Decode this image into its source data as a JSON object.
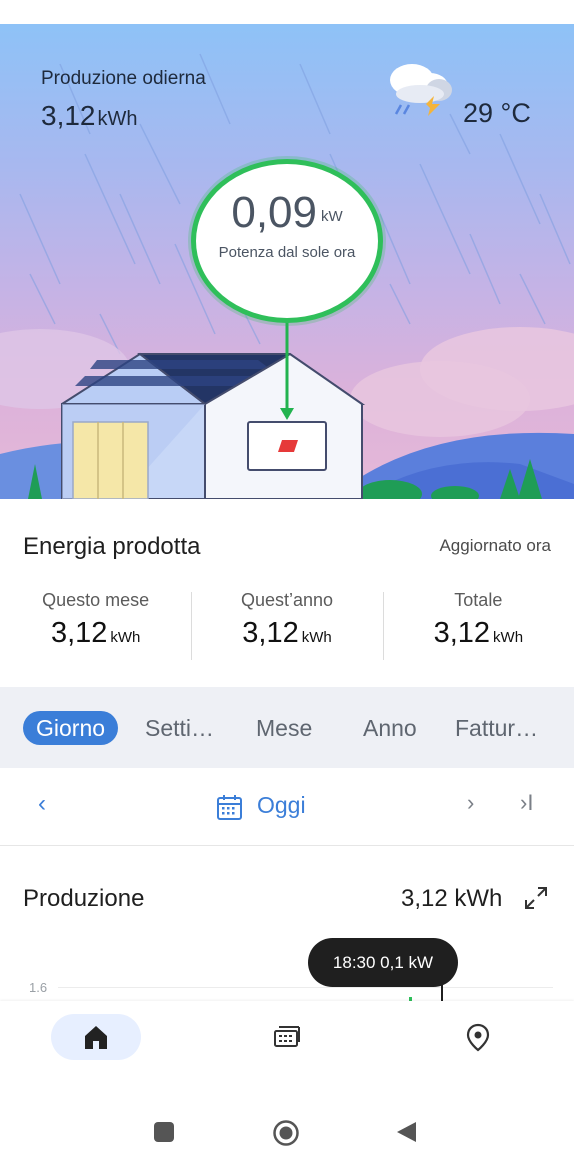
{
  "hero": {
    "label": "Produzione odierna",
    "value": "3,12",
    "unit": "kWh",
    "temperature": "29 °C",
    "weather_icon": "cloud-rain-lightning-icon",
    "bubble": {
      "value": "0,09",
      "unit": "kW",
      "label": "Potenza dal sole ora"
    }
  },
  "energy": {
    "title": "Energia prodotta",
    "updated": "Aggiornato ora",
    "stats": [
      {
        "label": "Questo mese",
        "value": "3,12",
        "unit": "kWh"
      },
      {
        "label": "Quest’anno",
        "value": "3,12",
        "unit": "kWh"
      },
      {
        "label": "Totale",
        "value": "3,12",
        "unit": "kWh"
      }
    ]
  },
  "tabs": [
    {
      "label": "Giorno",
      "active": true
    },
    {
      "label": "Setti…",
      "active": false
    },
    {
      "label": "Mese",
      "active": false
    },
    {
      "label": "Anno",
      "active": false
    },
    {
      "label": "Fattur…",
      "active": false
    }
  ],
  "datenav": {
    "prev": "‹",
    "label": "Oggi",
    "next": "›",
    "last": "›I"
  },
  "production": {
    "title": "Produzione",
    "value": "3,12 kWh",
    "axis_tick": "1.6",
    "tooltip": "18:30 0,1 kW"
  },
  "bottom_nav": [
    "home-icon",
    "devices-icon",
    "location-icon"
  ],
  "colors": {
    "accent": "#3b7ed8",
    "green": "#2fbf5a",
    "tabs_bg": "#eef0f5"
  }
}
